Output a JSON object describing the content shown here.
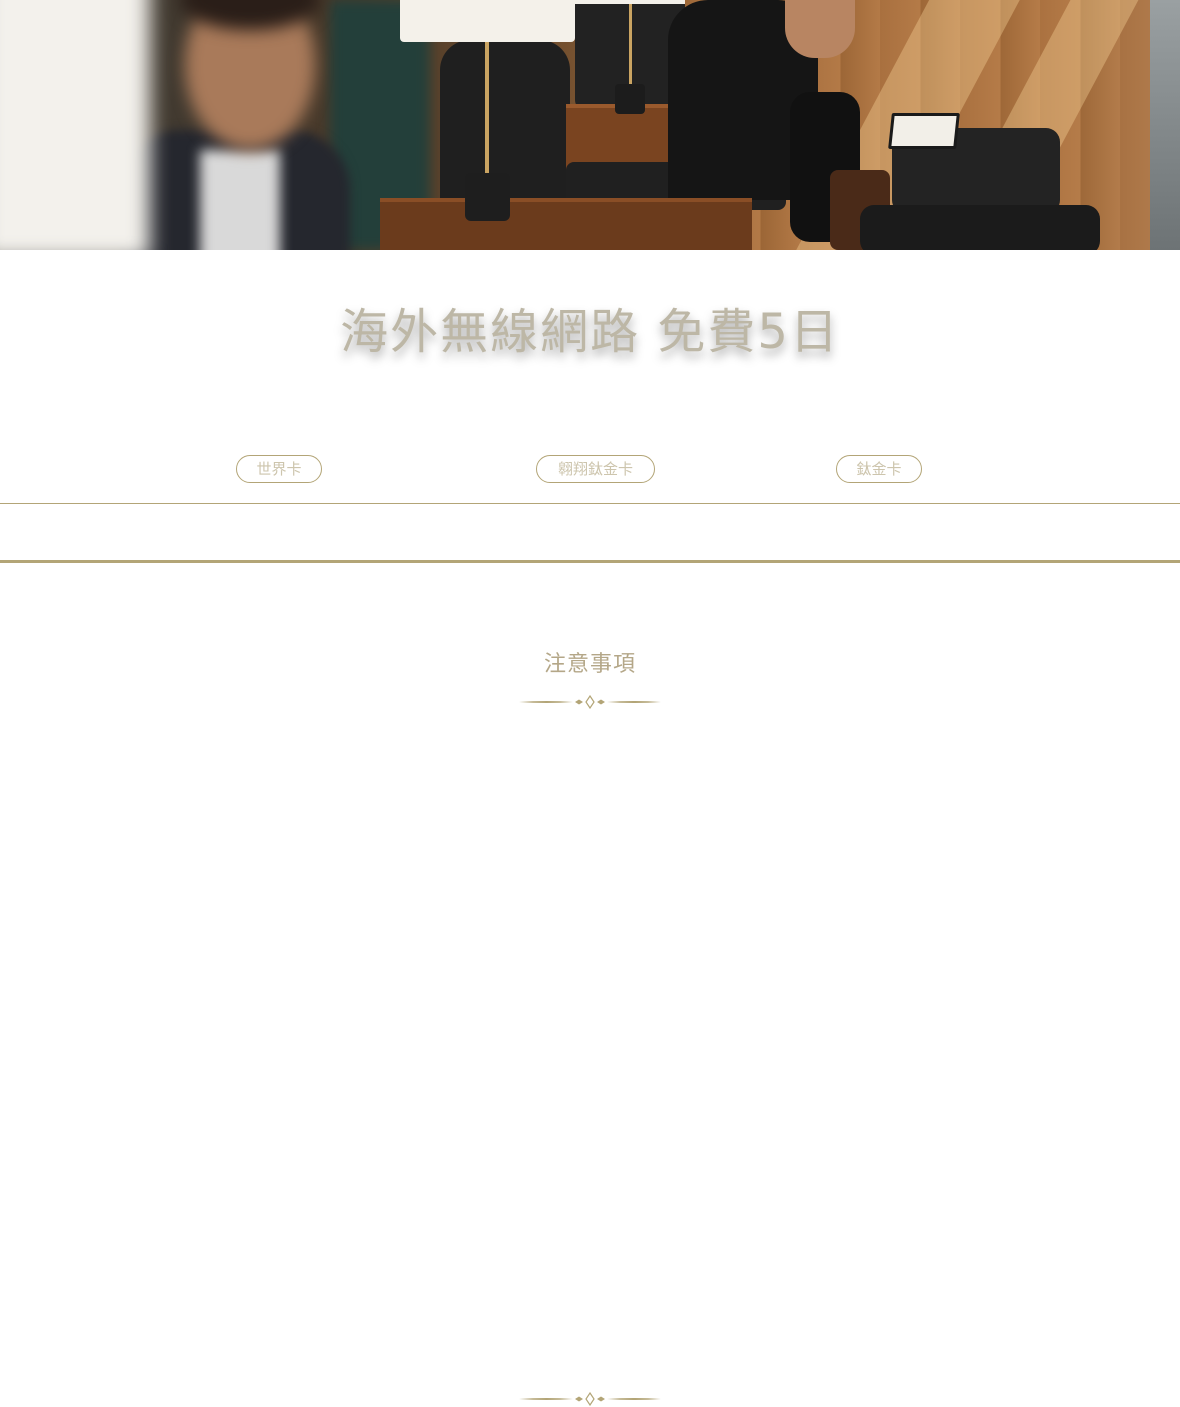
{
  "hero": {
    "image_description_icon": "lounge-photo"
  },
  "promo": {
    "title": "海外無線網路 免費5日"
  },
  "tabs": [
    {
      "label": "世界卡"
    },
    {
      "label": "翱翔鈦金卡"
    },
    {
      "label": "鈦金卡"
    }
  ],
  "notes": {
    "title": "注意事項",
    "ornament_icon": "divider-ornament-icon"
  },
  "colors": {
    "accent_gold": "#b3a577",
    "title_gray": "#bdb7a6",
    "tab_text": "#cdc5ad",
    "notes_title": "#b4a788"
  }
}
